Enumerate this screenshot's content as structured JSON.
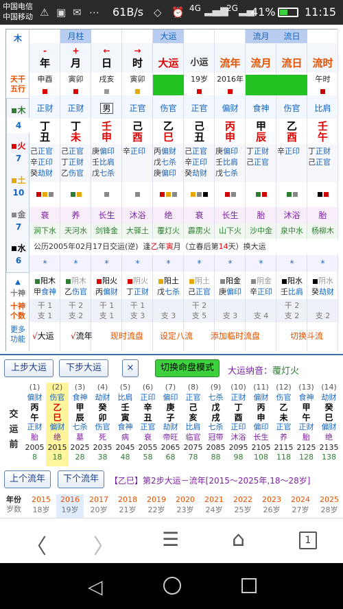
{
  "status": {
    "carrier1": "中国电信",
    "carrier2": "中国移动",
    "speed": "61B/s",
    "net1": "4G",
    "net2": "2G",
    "battery": "41%",
    "time": "11:15"
  },
  "side": {
    "corner": "木",
    "tg1": "天干",
    "tg2": "五行",
    "el": [
      {
        "n": "木",
        "c": "4",
        "col": "#2e7d32"
      },
      {
        "n": "火",
        "c": "7",
        "col": "#d00"
      },
      {
        "n": "土",
        "c": "10",
        "col": "#e6a800"
      },
      {
        "n": "金",
        "c": "7",
        "col": "#888"
      },
      {
        "n": "水",
        "c": "6",
        "col": "#000"
      }
    ],
    "shishen": "十神",
    "geshu": "个数",
    "more1": "更多",
    "more2": "功能"
  },
  "cols": [
    {
      "h1": "",
      "h2": "-",
      "h3": "年",
      "w": "申酉",
      "ws": "#d00",
      "ss": "正财",
      "g": "丁",
      "z": "丑",
      "hid": [
        [
          "己",
          "正官"
        ],
        [
          "辛",
          "正印"
        ],
        [
          "癸",
          "劫财"
        ]
      ],
      "sq": [
        "#c00",
        "#e6a800",
        "#888"
      ],
      "cs": "衰",
      "ny": "涧下水",
      "xing": "阳木",
      "xg": "甲",
      "xs": "食神",
      "gc": "干 1",
      "zc": "支 1"
    },
    {
      "h1": "月柱",
      "h2": "+",
      "h3": "月",
      "w": "寅卯",
      "ws": "#d00",
      "ss": "正财",
      "g": "丁",
      "z": "未",
      "hid": [
        [
          "己",
          "正官"
        ],
        [
          "丁",
          "正财"
        ],
        [
          "乙",
          "伤官"
        ]
      ],
      "sq": [
        "#2e7d32",
        "#e6a800"
      ],
      "cs": "养",
      "ny": "天河水",
      "xing": "阴木",
      "xg": "乙",
      "xs": "伤官",
      "gc": "干 2",
      "zc": "支 2"
    },
    {
      "h1": "",
      "h2": "←",
      "h3": "日",
      "w": "戌亥",
      "ws": "#999",
      "ss": "男",
      "g": "壬",
      "z": "申",
      "hid": [
        [
          "庚",
          "偏印"
        ],
        [
          "壬",
          "比肩"
        ],
        [
          "戊",
          "七杀"
        ]
      ],
      "sq": [
        "#888"
      ],
      "cs": "长生",
      "ny": "剑锋金",
      "xing": "阳火",
      "xg": "丙",
      "xs": "偏财",
      "gc": "干 1",
      "zc": "支 1"
    },
    {
      "h1": "",
      "h2": "→",
      "h3": "时",
      "w": "寅卯",
      "ws": "#e6a800",
      "ss": "正官",
      "g": "己",
      "z": "酉",
      "hid": [
        [
          "辛",
          "正印"
        ]
      ],
      "sq": [
        "#888"
      ],
      "cs": "沐浴",
      "ny": "大驿土",
      "xing": "阴火",
      "xg": "丁",
      "xs": "正财",
      "gc": "干 1",
      "zc": "支 3"
    },
    {
      "h1": "大运",
      "h2": "",
      "h3": "大运",
      "w": "",
      "ws": "",
      "ss": "伤官",
      "g": "乙",
      "z": "巳",
      "hid": [
        [
          "丙",
          "偏财"
        ],
        [
          "戊",
          "七杀"
        ],
        [
          "庚",
          "偏印"
        ]
      ],
      "sq": [
        "#c00",
        "#e6a800",
        "#888"
      ],
      "cs": "绝",
      "ny": "覆灯火",
      "xing": "阳土",
      "xg": "戊",
      "xs": "七杀",
      "gc": "",
      "zc": "支 3"
    },
    {
      "h1": "",
      "h2": "",
      "h3": "小运",
      "w": "19岁",
      "ws": "#d00",
      "ss": "正官",
      "g": "己",
      "z": "丑",
      "hid": [
        [
          "己",
          "正官"
        ],
        [
          "辛",
          "正印"
        ],
        [
          "癸",
          "劫财"
        ]
      ],
      "sq": [
        "#e6a800",
        "#888",
        "#000"
      ],
      "cs": "衰",
      "ny": "霹雳火",
      "xing": "阴土",
      "xg": "己",
      "xs": "正官",
      "gc": "干 2",
      "zc": "支 5"
    },
    {
      "h1": "",
      "h2": "",
      "h3": "流年",
      "w": "2016年",
      "ws": "#d00",
      "ss": "偏财",
      "g": "丙",
      "z": "申",
      "hid": [
        [
          "庚",
          "偏印"
        ],
        [
          "壬",
          "比肩"
        ],
        [
          "戊",
          "七杀"
        ]
      ],
      "sq": [
        "#c00",
        "#888"
      ],
      "cs": "长生",
      "ny": "山下火",
      "xing": "阳金",
      "xg": "庚",
      "xs": "偏印",
      "gc": "",
      "zc": "支 3"
    },
    {
      "h1": "流月",
      "h2": "",
      "h3": "流月",
      "w": "",
      "ws": "",
      "ss": "食神",
      "g": "甲",
      "z": "辰",
      "hid": [
        [
          "丁",
          "正财"
        ],
        [
          "己",
          "正官"
        ]
      ],
      "sq": [
        "#2e7d32",
        "#c00"
      ],
      "cs": "胎",
      "ny": "沙中金",
      "xing": "阴金",
      "xg": "辛",
      "xs": "正印",
      "gc": "",
      "zc": "支 4"
    },
    {
      "h1": "流日",
      "h2": "",
      "h3": "流日",
      "w": "",
      "ws": "",
      "ss": "伤官",
      "g": "乙",
      "z": "酉",
      "hid": [
        [
          "辛",
          "正印"
        ]
      ],
      "sq": [
        "#2e7d32",
        "#888"
      ],
      "cs": "沐浴",
      "ny": "泉中水",
      "xing": "阳水",
      "xg": "壬",
      "xs": "比肩",
      "gc": "干 2",
      "zc": "支 2"
    },
    {
      "h1": "",
      "h2": "",
      "h3": "流时",
      "w": "午时",
      "ws": "#c00",
      "ss": "比肩",
      "g": "壬",
      "z": "午",
      "hid": [
        [
          "丁",
          "正财"
        ],
        [
          "己",
          "正官"
        ]
      ],
      "sq": [
        "#000",
        "#c00"
      ],
      "cs": "胎",
      "ny": "杨柳木",
      "xing": "阴水",
      "xg": "癸",
      "xs": "劫财",
      "gc": "",
      "zc": "支 2"
    }
  ],
  "dayun_info": {
    "p1": "公历2005年02月17日交运(逆)",
    "p2": "逢",
    "p3": "乙",
    "p4": "年",
    "p5": "寅",
    "p6": "月（立春后第",
    "p7": "14",
    "p8": "天）换大运"
  },
  "links": [
    "大运",
    "流年",
    "现时流盘",
    "设定八流",
    "添加临时流盘",
    "切换斗流"
  ],
  "lower": {
    "prev_dayun": "上步大运",
    "next_dayun": "下步大运",
    "close": "×",
    "switch": "切换命盘模式",
    "nayin_label": "大运纳音：",
    "nayin_val": "覆灯火",
    "jiaoyun": [
      "交",
      "运",
      "前"
    ],
    "dayuns": [
      {
        "n": "(1)",
        "ss": "偏财",
        "g": "丙",
        "z": "午",
        "zs": "正财",
        "cs": "胎",
        "y": "2005",
        "a": "8"
      },
      {
        "n": "(2)",
        "ss": "伤官",
        "g": "乙",
        "z": "巳",
        "zs": "偏财",
        "cs": "绝",
        "y": "2015",
        "a": "18"
      },
      {
        "n": "(3)",
        "ss": "食神",
        "g": "甲",
        "z": "辰",
        "zs": "七杀",
        "cs": "墓",
        "y": "2025",
        "a": "28"
      },
      {
        "n": "(4)",
        "ss": "劫财",
        "g": "癸",
        "z": "卯",
        "zs": "伤官",
        "cs": "死",
        "y": "2035",
        "a": "38"
      },
      {
        "n": "(5)",
        "ss": "比肩",
        "g": "壬",
        "z": "寅",
        "zs": "食神",
        "cs": "病",
        "y": "2045",
        "a": "48"
      },
      {
        "n": "(6)",
        "ss": "正印",
        "g": "辛",
        "z": "丑",
        "zs": "正官",
        "cs": "衰",
        "y": "2055",
        "a": "58"
      },
      {
        "n": "(7)",
        "ss": "偏印",
        "g": "庚",
        "z": "子",
        "zs": "劫财",
        "cs": "帝旺",
        "y": "2065",
        "a": "68"
      },
      {
        "n": "(8)",
        "ss": "正官",
        "g": "己",
        "z": "亥",
        "zs": "比肩",
        "cs": "临官",
        "y": "2075",
        "a": "78"
      },
      {
        "n": "(9)",
        "ss": "七杀",
        "g": "戊",
        "z": "戌",
        "zs": "七杀",
        "cs": "冠带",
        "y": "2085",
        "a": "88"
      },
      {
        "n": "(10)",
        "ss": "正财",
        "g": "丁",
        "z": "酉",
        "zs": "正印",
        "cs": "沐浴",
        "y": "2095",
        "a": "98"
      },
      {
        "n": "(11)",
        "ss": "偏财",
        "g": "丙",
        "z": "申",
        "zs": "偏印",
        "cs": "长生",
        "y": "2105",
        "a": "108"
      },
      {
        "n": "(12)",
        "ss": "伤官",
        "g": "乙",
        "z": "未",
        "zs": "正官",
        "cs": "养",
        "y": "2115",
        "a": "118"
      },
      {
        "n": "(13)",
        "ss": "食神",
        "g": "甲",
        "z": "午",
        "zs": "正财",
        "cs": "胎",
        "y": "2125",
        "a": "128"
      },
      {
        "n": "(14)",
        "ss": "劫财",
        "g": "癸",
        "z": "巳",
        "zs": "偏财",
        "cs": "绝",
        "y": "2135",
        "a": "138"
      }
    ],
    "prev_ln": "上个流年",
    "next_ln": "下个流年",
    "ln_title": "【乙巳】第2步大运－流年[2015～2025年,18～28岁]",
    "row_y": "年份",
    "row_a": "岁数",
    "years": [
      [
        "2015",
        "18岁"
      ],
      [
        "2016",
        "19岁"
      ],
      [
        "2017",
        "20岁"
      ],
      [
        "2018",
        "21岁"
      ],
      [
        "2019",
        "22岁"
      ],
      [
        "2020",
        "23岁"
      ],
      [
        "2021",
        "24岁"
      ],
      [
        "2022",
        "25岁"
      ],
      [
        "2023",
        "26岁"
      ],
      [
        "2024",
        "27岁"
      ],
      [
        "2025",
        "28岁"
      ]
    ]
  },
  "nav": {
    "page": "1"
  }
}
